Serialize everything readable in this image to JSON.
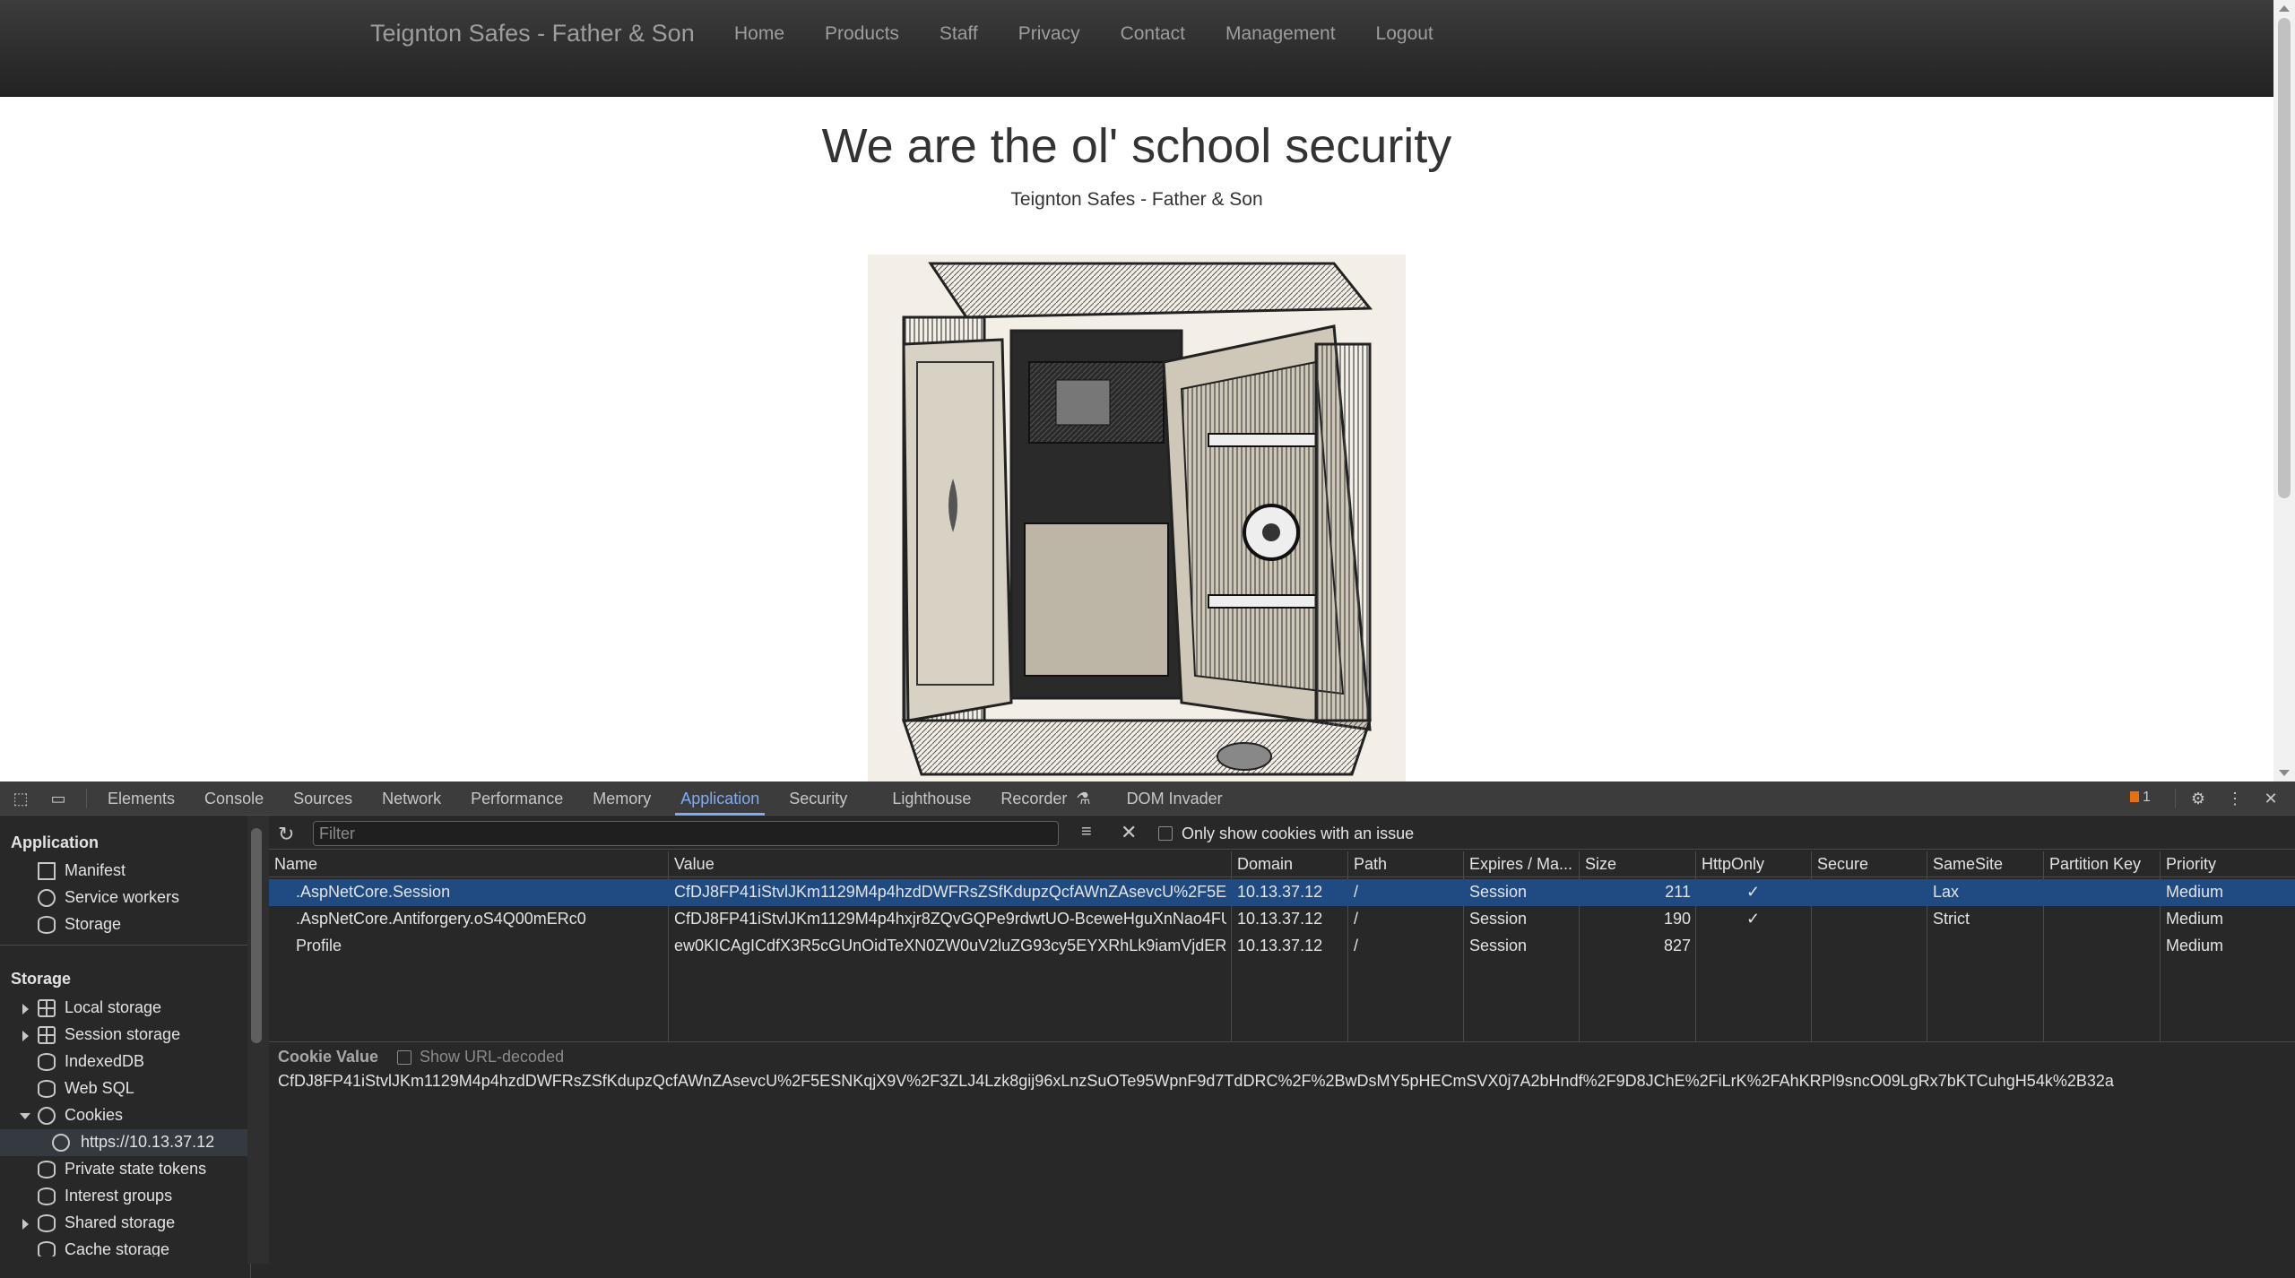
{
  "site": {
    "brand": "Teignton Safes - Father & Son",
    "nav": [
      "Home",
      "Products",
      "Staff",
      "Privacy",
      "Contact",
      "Management",
      "Logout"
    ],
    "hero_title": "We are the ol' school security",
    "hero_subtitle": "Teignton Safes - Father & Son"
  },
  "devtools": {
    "tabs": [
      "Elements",
      "Console",
      "Sources",
      "Network",
      "Performance",
      "Memory",
      "Application",
      "Security",
      "Lighthouse",
      "Recorder",
      "DOM Invader"
    ],
    "active_tab": "Application",
    "issues_count": "1",
    "sidebar": {
      "app_section": "Application",
      "app_items": [
        "Manifest",
        "Service workers",
        "Storage"
      ],
      "storage_section": "Storage",
      "storage_items": [
        "Local storage",
        "Session storage",
        "IndexedDB",
        "Web SQL",
        "Cookies",
        "https://10.13.37.12",
        "Private state tokens",
        "Interest groups",
        "Shared storage",
        "Cache storage"
      ]
    },
    "filter": {
      "placeholder": "Filter",
      "only_issues_label": "Only show cookies with an issue"
    },
    "columns": [
      "Name",
      "Value",
      "Domain",
      "Path",
      "Expires / Ma...",
      "Size",
      "HttpOnly",
      "Secure",
      "SameSite",
      "Partition Key",
      "Priority"
    ],
    "cookies": [
      {
        "name": ".AspNetCore.Session",
        "value": "CfDJ8FP41iStvlJKm1129M4p4hzdDWFRsZSfKdupzQcfAWnZAsevcU%2F5ESN...",
        "domain": "10.13.37.12",
        "path": "/",
        "expires": "Session",
        "size": "211",
        "httponly": "✓",
        "secure": "",
        "samesite": "Lax",
        "partition": "",
        "priority": "Medium"
      },
      {
        "name": ".AspNetCore.Antiforgery.oS4Q00mERc0",
        "value": "CfDJ8FP41iStvlJKm1129M4p4hxjr8ZQvGQPe9rdwtUO-BceweHguXnNao4FU...",
        "domain": "10.13.37.12",
        "path": "/",
        "expires": "Session",
        "size": "190",
        "httponly": "✓",
        "secure": "",
        "samesite": "Strict",
        "partition": "",
        "priority": "Medium"
      },
      {
        "name": "Profile",
        "value": "ew0KICAgICdfX3R5cGUnOidTeXN0ZW0uV2luZG93cy5EYXRhLk9iamVjdERhd...",
        "domain": "10.13.37.12",
        "path": "/",
        "expires": "Session",
        "size": "827",
        "httponly": "",
        "secure": "",
        "samesite": "",
        "partition": "",
        "priority": "Medium"
      }
    ],
    "cookie_value_title": "Cookie Value",
    "show_url_decoded": "Show URL-decoded",
    "cookie_value": "CfDJ8FP41iStvlJKm1129M4p4hzdDWFRsZSfKdupzQcfAWnZAsevcU%2F5ESNKqjX9V%2F3ZLJ4Lzk8gij96xLnzSuOTe95WpnF9d7TdDRC%2F%2BwDsMY5pHECmSVX0j7A2bHndf%2F9D8JChE%2FiLrK%2FAhKRPl9sncO09LgRx7bKTCuhgH54k%2B32a"
  }
}
